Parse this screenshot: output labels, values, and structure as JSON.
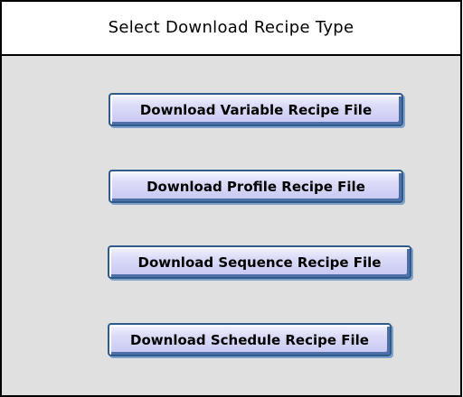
{
  "dialog": {
    "title": "Select Download Recipe Type"
  },
  "buttons": {
    "variable": "Download Variable Recipe File",
    "profile": "Download Profile Recipe File",
    "sequence": "Download Sequence Recipe File",
    "schedule": "Download Schedule Recipe File"
  },
  "colors": {
    "panel_background": "#e0e0e0",
    "button_face": "#c7c7f2",
    "button_border": "#2f5a8a"
  }
}
